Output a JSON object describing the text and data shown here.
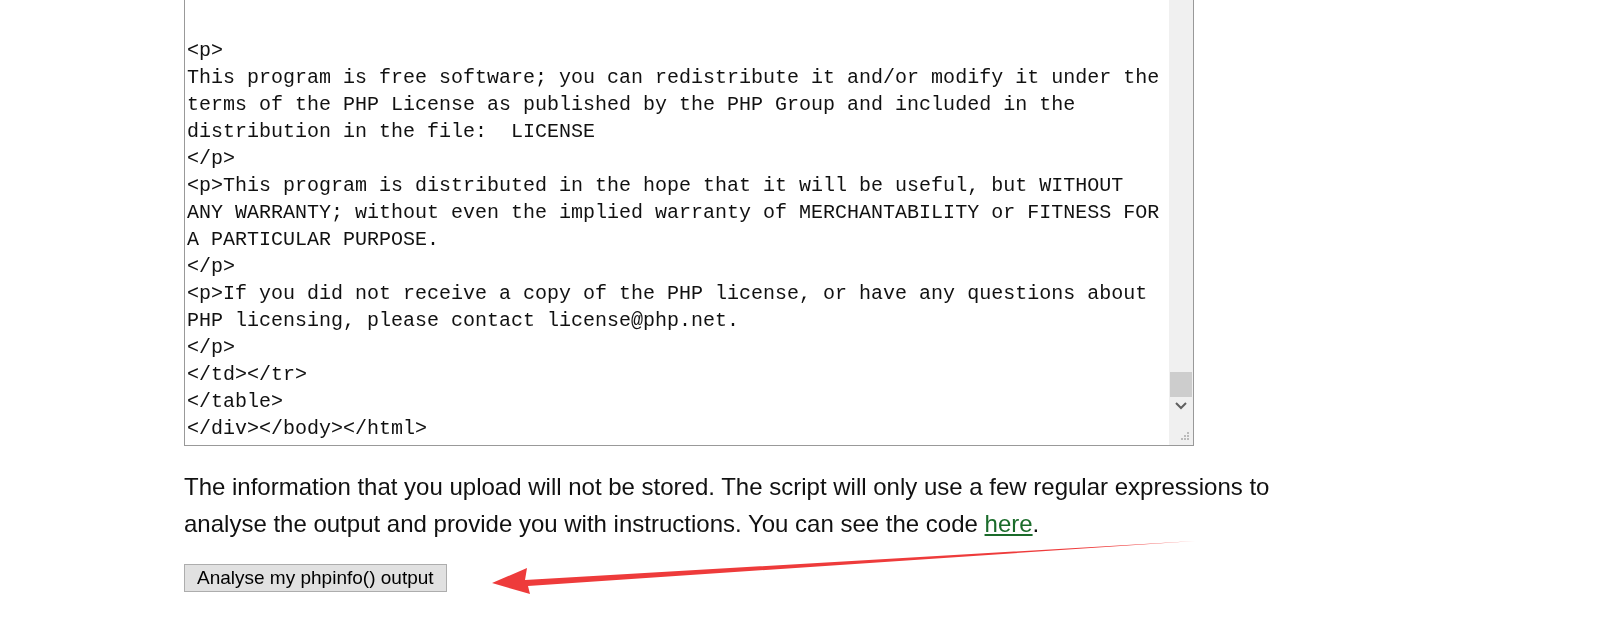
{
  "source_textarea": {
    "lines": [
      "<p>",
      "This program is free software; you can redistribute it and/or modify it under the",
      "terms of the PHP License as published by the PHP Group and included in the",
      "distribution in the file:  LICENSE",
      "</p>",
      "<p>This program is distributed in the hope that it will be useful, but WITHOUT",
      "ANY WARRANTY; without even the implied warranty of MERCHANTABILITY or FITNESS FOR",
      "A PARTICULAR PURPOSE.",
      "</p>",
      "<p>If you did not receive a copy of the PHP license, or have any questions about",
      "PHP licensing, please contact license@php.net.",
      "</p>",
      "</td></tr>",
      "</table>",
      "</div></body></html>"
    ]
  },
  "notice": {
    "text": "The information that you upload will not be stored. The script will only use a few regular expressions to analyse the output and provide you with instructions. You can see the code",
    "link": "here",
    "end": "."
  },
  "submit_button": {
    "label": "Analyse my phpinfo() output"
  }
}
